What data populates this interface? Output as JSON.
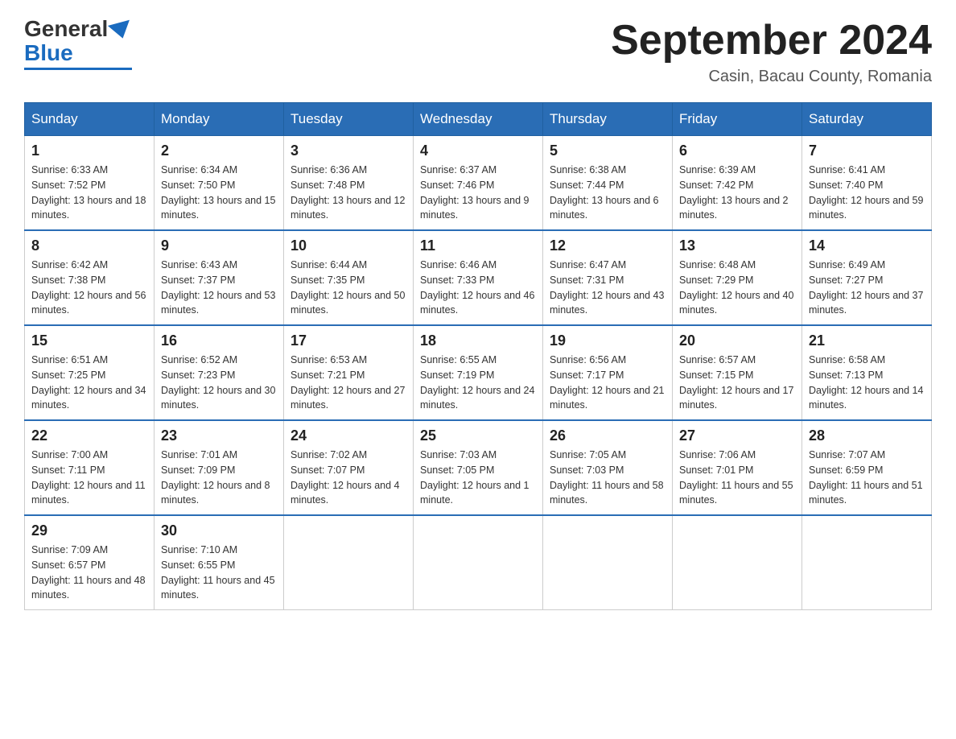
{
  "header": {
    "logo_text_general": "General",
    "logo_text_blue": "Blue",
    "month_title": "September 2024",
    "location": "Casin, Bacau County, Romania"
  },
  "weekdays": [
    "Sunday",
    "Monday",
    "Tuesday",
    "Wednesday",
    "Thursday",
    "Friday",
    "Saturday"
  ],
  "weeks": [
    [
      {
        "day": "1",
        "sunrise": "6:33 AM",
        "sunset": "7:52 PM",
        "daylight": "13 hours and 18 minutes."
      },
      {
        "day": "2",
        "sunrise": "6:34 AM",
        "sunset": "7:50 PM",
        "daylight": "13 hours and 15 minutes."
      },
      {
        "day": "3",
        "sunrise": "6:36 AM",
        "sunset": "7:48 PM",
        "daylight": "13 hours and 12 minutes."
      },
      {
        "day": "4",
        "sunrise": "6:37 AM",
        "sunset": "7:46 PM",
        "daylight": "13 hours and 9 minutes."
      },
      {
        "day": "5",
        "sunrise": "6:38 AM",
        "sunset": "7:44 PM",
        "daylight": "13 hours and 6 minutes."
      },
      {
        "day": "6",
        "sunrise": "6:39 AM",
        "sunset": "7:42 PM",
        "daylight": "13 hours and 2 minutes."
      },
      {
        "day": "7",
        "sunrise": "6:41 AM",
        "sunset": "7:40 PM",
        "daylight": "12 hours and 59 minutes."
      }
    ],
    [
      {
        "day": "8",
        "sunrise": "6:42 AM",
        "sunset": "7:38 PM",
        "daylight": "12 hours and 56 minutes."
      },
      {
        "day": "9",
        "sunrise": "6:43 AM",
        "sunset": "7:37 PM",
        "daylight": "12 hours and 53 minutes."
      },
      {
        "day": "10",
        "sunrise": "6:44 AM",
        "sunset": "7:35 PM",
        "daylight": "12 hours and 50 minutes."
      },
      {
        "day": "11",
        "sunrise": "6:46 AM",
        "sunset": "7:33 PM",
        "daylight": "12 hours and 46 minutes."
      },
      {
        "day": "12",
        "sunrise": "6:47 AM",
        "sunset": "7:31 PM",
        "daylight": "12 hours and 43 minutes."
      },
      {
        "day": "13",
        "sunrise": "6:48 AM",
        "sunset": "7:29 PM",
        "daylight": "12 hours and 40 minutes."
      },
      {
        "day": "14",
        "sunrise": "6:49 AM",
        "sunset": "7:27 PM",
        "daylight": "12 hours and 37 minutes."
      }
    ],
    [
      {
        "day": "15",
        "sunrise": "6:51 AM",
        "sunset": "7:25 PM",
        "daylight": "12 hours and 34 minutes."
      },
      {
        "day": "16",
        "sunrise": "6:52 AM",
        "sunset": "7:23 PM",
        "daylight": "12 hours and 30 minutes."
      },
      {
        "day": "17",
        "sunrise": "6:53 AM",
        "sunset": "7:21 PM",
        "daylight": "12 hours and 27 minutes."
      },
      {
        "day": "18",
        "sunrise": "6:55 AM",
        "sunset": "7:19 PM",
        "daylight": "12 hours and 24 minutes."
      },
      {
        "day": "19",
        "sunrise": "6:56 AM",
        "sunset": "7:17 PM",
        "daylight": "12 hours and 21 minutes."
      },
      {
        "day": "20",
        "sunrise": "6:57 AM",
        "sunset": "7:15 PM",
        "daylight": "12 hours and 17 minutes."
      },
      {
        "day": "21",
        "sunrise": "6:58 AM",
        "sunset": "7:13 PM",
        "daylight": "12 hours and 14 minutes."
      }
    ],
    [
      {
        "day": "22",
        "sunrise": "7:00 AM",
        "sunset": "7:11 PM",
        "daylight": "12 hours and 11 minutes."
      },
      {
        "day": "23",
        "sunrise": "7:01 AM",
        "sunset": "7:09 PM",
        "daylight": "12 hours and 8 minutes."
      },
      {
        "day": "24",
        "sunrise": "7:02 AM",
        "sunset": "7:07 PM",
        "daylight": "12 hours and 4 minutes."
      },
      {
        "day": "25",
        "sunrise": "7:03 AM",
        "sunset": "7:05 PM",
        "daylight": "12 hours and 1 minute."
      },
      {
        "day": "26",
        "sunrise": "7:05 AM",
        "sunset": "7:03 PM",
        "daylight": "11 hours and 58 minutes."
      },
      {
        "day": "27",
        "sunrise": "7:06 AM",
        "sunset": "7:01 PM",
        "daylight": "11 hours and 55 minutes."
      },
      {
        "day": "28",
        "sunrise": "7:07 AM",
        "sunset": "6:59 PM",
        "daylight": "11 hours and 51 minutes."
      }
    ],
    [
      {
        "day": "29",
        "sunrise": "7:09 AM",
        "sunset": "6:57 PM",
        "daylight": "11 hours and 48 minutes."
      },
      {
        "day": "30",
        "sunrise": "7:10 AM",
        "sunset": "6:55 PM",
        "daylight": "11 hours and 45 minutes."
      },
      null,
      null,
      null,
      null,
      null
    ]
  ]
}
